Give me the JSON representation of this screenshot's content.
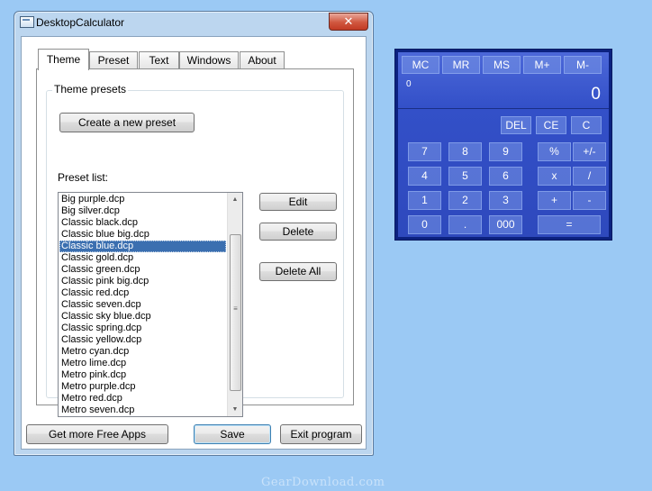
{
  "window": {
    "title": "DesktopCalculator"
  },
  "tabs": [
    "Theme",
    "Preset",
    "Text",
    "Windows",
    "About"
  ],
  "theme": {
    "group_label": "Theme presets",
    "create_button": "Create a new preset",
    "list_label": "Preset list:",
    "items": [
      "Big purple.dcp",
      "Big silver.dcp",
      "Classic black.dcp",
      "Classic blue big.dcp",
      "Classic blue.dcp",
      "Classic gold.dcp",
      "Classic green.dcp",
      "Classic pink big.dcp",
      "Classic red.dcp",
      "Classic seven.dcp",
      "Classic sky blue.dcp",
      "Classic spring.dcp",
      "Classic yellow.dcp",
      "Metro cyan.dcp",
      "Metro lime.dcp",
      "Metro pink.dcp",
      "Metro purple.dcp",
      "Metro red.dcp",
      "Metro seven.dcp"
    ],
    "selected": "Classic blue.dcp",
    "edit_button": "Edit",
    "delete_button": "Delete",
    "delete_all_button": "Delete All"
  },
  "footer": {
    "more_apps": "Get more Free Apps",
    "save": "Save",
    "exit": "Exit program"
  },
  "calculator": {
    "memory_buttons": [
      "MC",
      "MR",
      "MS",
      "M+",
      "M-"
    ],
    "memory_value": "0",
    "display_value": "0",
    "edit_buttons": [
      "DEL",
      "CE",
      "C"
    ],
    "rows": [
      [
        "7",
        "8",
        "9",
        "%",
        "+/-"
      ],
      [
        "4",
        "5",
        "6",
        "x",
        "/"
      ],
      [
        "1",
        "2",
        "3",
        "+",
        "-"
      ]
    ],
    "bottom": [
      "0",
      ".",
      "000",
      "="
    ]
  },
  "watermark": "GearDownload.com",
  "colors": {
    "desktop": "#9bc9f4",
    "calc_body": "#3350c8",
    "selection": "#3b6fb0"
  }
}
